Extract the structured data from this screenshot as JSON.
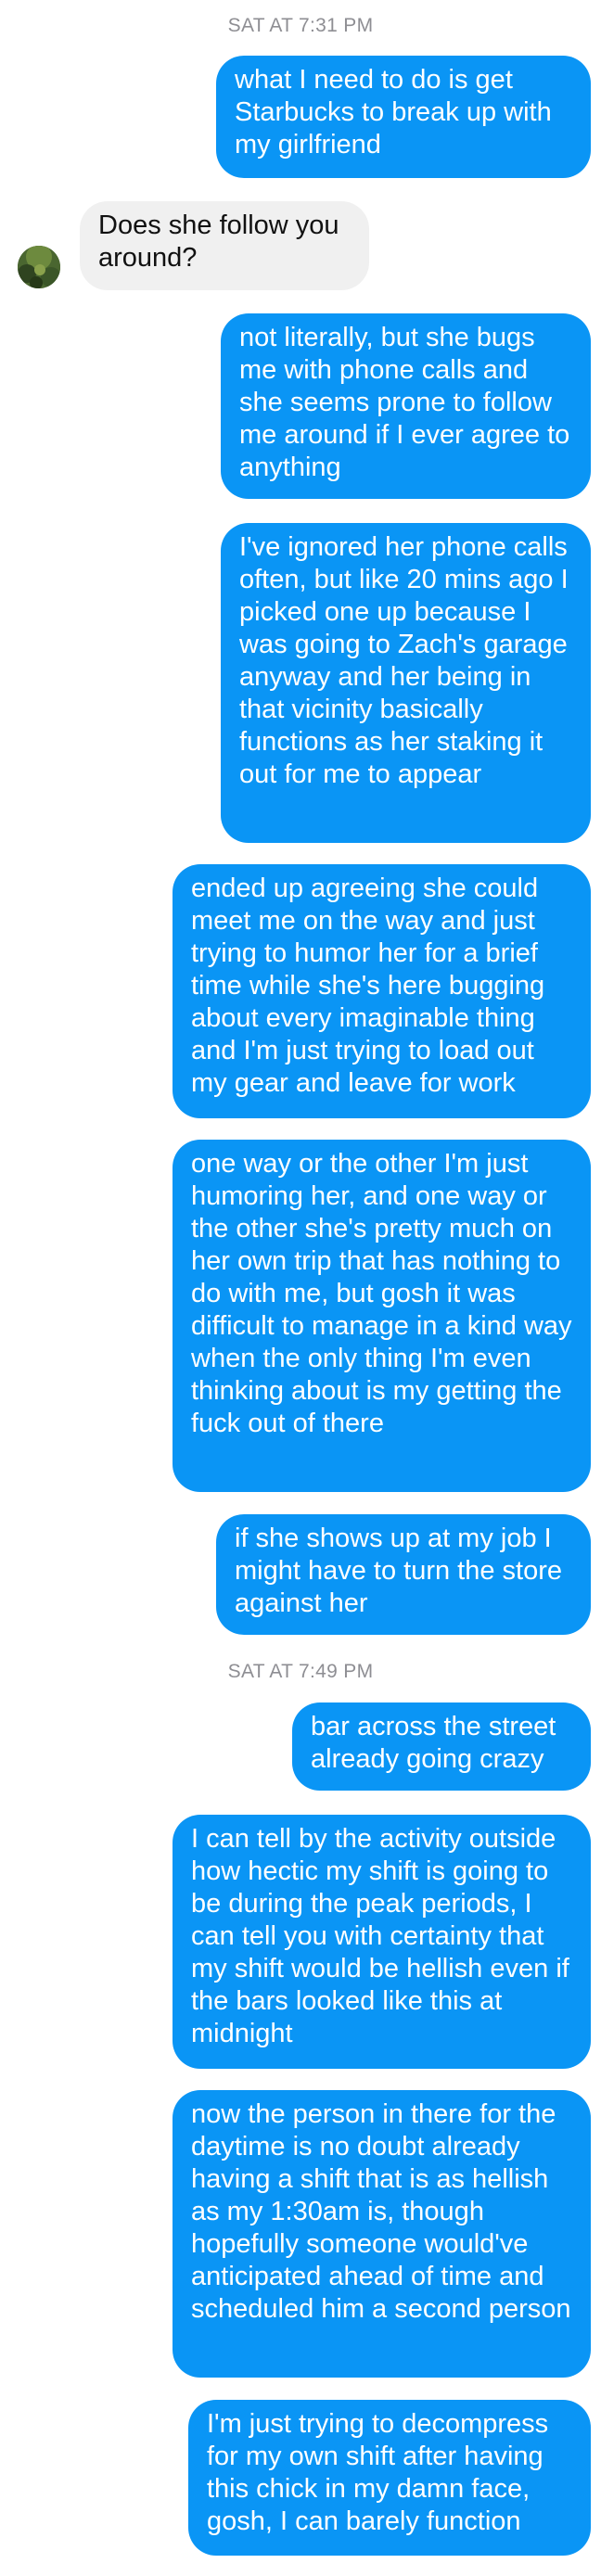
{
  "timestamps": {
    "first": "SAT AT 7:31 PM",
    "second": "SAT AT 7:49 PM"
  },
  "contact": {
    "avatar_icon": "profile-avatar-icon"
  },
  "colors": {
    "outgoing_bubble": "#0a95f5",
    "incoming_bubble": "#f0f0f0",
    "timestamp_text": "#8e8e93"
  },
  "messages": [
    {
      "direction": "outgoing",
      "text": "what I need to do is get Starbucks to break up with my girlfriend"
    },
    {
      "direction": "incoming",
      "text": "Does she follow you around?"
    },
    {
      "direction": "outgoing",
      "text": "not literally, but she bugs me with phone calls and she seems prone to follow me around if I ever agree to anything"
    },
    {
      "direction": "outgoing",
      "text": "I've ignored her phone calls often, but like 20 mins ago I picked one up because I was going to Zach's garage anyway and her being in that vicinity basically functions as her staking it out for me to appear"
    },
    {
      "direction": "outgoing",
      "text": "ended up agreeing she could meet me on the way and just trying to humor her for a brief time while she's here bugging about every imaginable thing and I'm just trying to load out my gear and leave for work"
    },
    {
      "direction": "outgoing",
      "text": "one way or the other I'm just humoring her, and one way or the other she's pretty much on her own trip that has nothing to do with me, but gosh it was difficult to manage in a kind way when the only thing I'm even thinking about is my getting the fuck out of there"
    },
    {
      "direction": "outgoing",
      "text": "if she shows up at my job I might have to turn the store against her"
    },
    {
      "direction": "outgoing",
      "text": "bar across the street already going crazy"
    },
    {
      "direction": "outgoing",
      "text": "I can tell by the activity outside how hectic my shift is going to be during the peak periods, I can tell you with certainty that my shift would be hellish even if the bars looked like this at midnight"
    },
    {
      "direction": "outgoing",
      "text": "now the person in there for the daytime is no doubt already having a shift that is as hellish as my 1:30am is, though hopefully someone would've anticipated ahead of time and scheduled him a second person"
    },
    {
      "direction": "outgoing",
      "text": "I'm just trying to decompress for my own shift after having this chick in my damn face, gosh, I can barely function"
    }
  ]
}
